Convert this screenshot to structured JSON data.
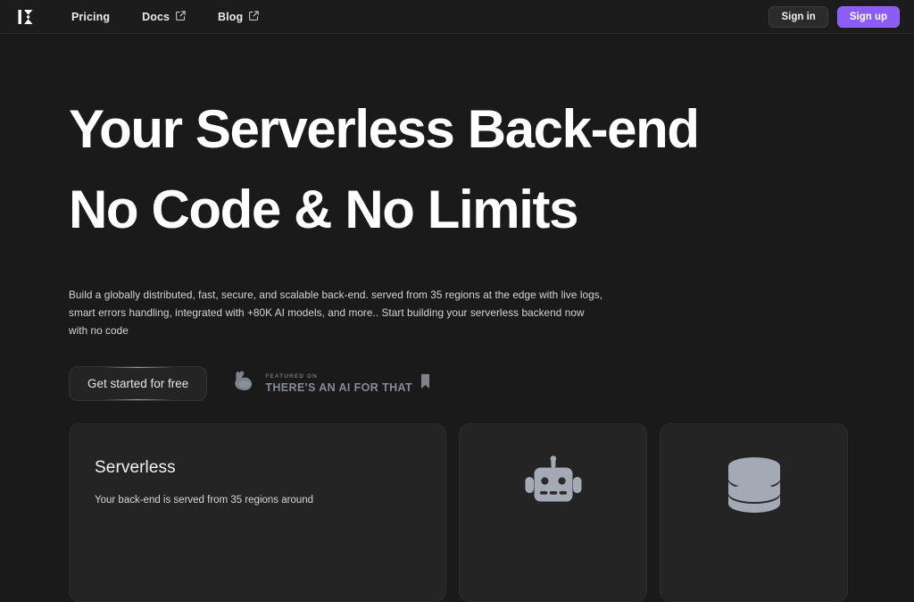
{
  "brand": {
    "logo_icon": "kuma-k-logo-icon",
    "accent_color": "#8b5cf6"
  },
  "header": {
    "nav": [
      {
        "label": "Pricing",
        "external": false
      },
      {
        "label": "Docs",
        "external": true,
        "icon": "external-link-icon"
      },
      {
        "label": "Blog",
        "external": true,
        "icon": "external-link-icon"
      }
    ],
    "actions": {
      "signin_label": "Sign in",
      "signup_label": "Sign up"
    }
  },
  "hero": {
    "title_line1": "Your Serverless Back-end",
    "title_line2": "No Code & No Limits",
    "subtitle": "Build a globally distributed, fast, secure, and scalable back-end. served from 35 regions at the edge with live logs, smart errors handling, integrated with +80K AI models, and more.. Start building your serverless backend now with no code",
    "cta_label": "Get started for free",
    "badge": {
      "kicker": "FEATURED ON",
      "title": "THERE'S AN AI FOR THAT",
      "left_icon": "flexed-biceps-icon",
      "right_icon": "bookmark-icon"
    }
  },
  "cards": [
    {
      "title": "Serverless",
      "description": "Your back-end is served from 35 regions around",
      "icon": null
    },
    {
      "title": "",
      "description": "",
      "icon": "robot-icon"
    },
    {
      "title": "",
      "description": "",
      "icon": "database-icon"
    }
  ]
}
